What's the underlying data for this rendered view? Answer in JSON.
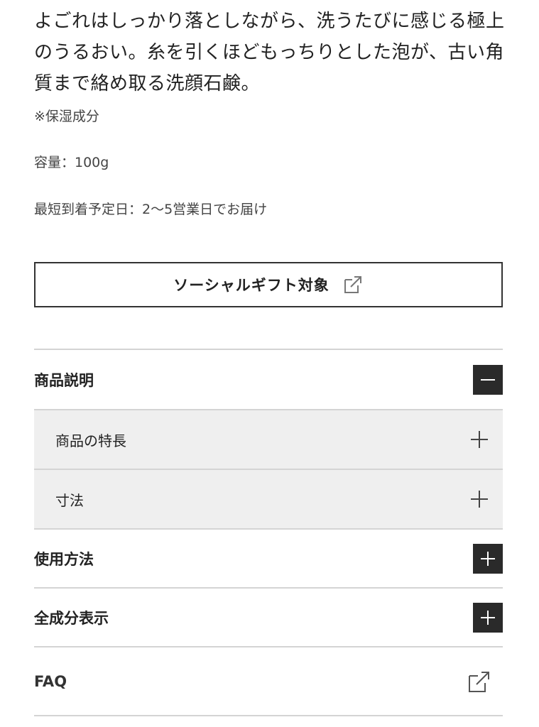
{
  "product": {
    "description": "よごれはしっかり落としながら、洗うたびに感じる極上のうるおい。糸を引くほどもっちりとした泡が、古い角質まで絡め取る洗顔石鹸。",
    "note": "※保湿成分",
    "volume": "容量：100g",
    "delivery": "最短到着予定日：2〜5営業日でお届け"
  },
  "gift_button": {
    "label": "ソーシャルギフト対象",
    "icon": "external-link-icon"
  },
  "accordion": {
    "sections": [
      {
        "label": "商品説明",
        "state": "expanded",
        "icon": "minus-icon"
      },
      {
        "label": "商品の特長",
        "state": "collapsed",
        "icon": "plus-icon"
      },
      {
        "label": "寸法",
        "state": "collapsed",
        "icon": "plus-icon"
      },
      {
        "label": "使用方法",
        "state": "collapsed",
        "icon": "plus-icon"
      },
      {
        "label": "全成分表示",
        "state": "collapsed",
        "icon": "plus-icon"
      },
      {
        "label": "FAQ",
        "icon": "external-link-icon"
      }
    ]
  },
  "colors": {
    "text": "#222222",
    "muted": "#444444",
    "divider": "#d4d4d4",
    "sub_bg": "#efefef",
    "toggle_bg": "#2a2a2a"
  }
}
